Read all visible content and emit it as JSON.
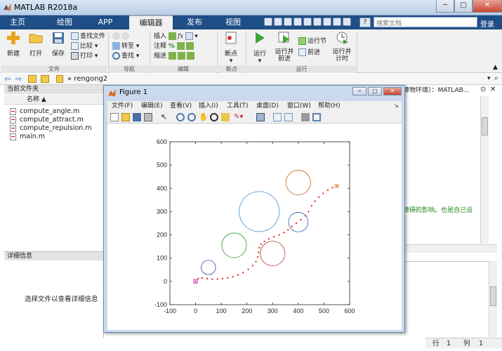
{
  "window": {
    "title": "MATLAB R2018a",
    "minimize": "─",
    "maximize": "□",
    "close": "✕"
  },
  "tabs": [
    {
      "label": "主页"
    },
    {
      "label": "绘图"
    },
    {
      "label": "APP"
    },
    {
      "label": "编辑器",
      "active": true
    },
    {
      "label": "发布"
    },
    {
      "label": "视图"
    }
  ],
  "search": {
    "placeholder": "搜索文档"
  },
  "login": "登录",
  "ribbon": {
    "file": {
      "new": "新建",
      "open": "打开",
      "save": "保存",
      "find_files": "查找文件",
      "compare": "比较",
      "print": "打印",
      "group": "文件"
    },
    "navigate": {
      "goto": "转至",
      "find": "查找",
      "group": "导航"
    },
    "edit": {
      "insert": "插入",
      "comment": "注释",
      "indent": "缩进",
      "group": "编辑"
    },
    "breakpoints": {
      "label": "断点",
      "group": "断点"
    },
    "run": {
      "run": "运行",
      "run_advance": "运行并前进",
      "run_section": "运行节",
      "advance": "前进",
      "run_time": "运行并计时",
      "group": "运行"
    }
  },
  "address": {
    "path": "« rengong2"
  },
  "current_folder": {
    "title": "当前文件夹",
    "column": "名称 ▲",
    "files": [
      "compute_angle.m",
      "compute_attract.m",
      "compute_repulsion.m",
      "main.m"
    ]
  },
  "details": {
    "title": "详细信息",
    "text": "选择文件以查看详细信息"
  },
  "workspace_title": "障物环境）：MATLAB...",
  "editor_snippet": "障碍的影响。也是自己设",
  "status": {
    "row_label": "行",
    "row": "1",
    "col_label": "列",
    "col": "1"
  },
  "figure": {
    "title": "Figure 1",
    "menu": [
      "文件(F)",
      "编辑(E)",
      "查看(V)",
      "插入(I)",
      "工具(T)",
      "桌面(D)",
      "窗口(W)",
      "帮助(H)"
    ]
  },
  "chart_data": {
    "type": "scatter",
    "title": "",
    "xlabel": "",
    "ylabel": "",
    "xlim": [
      -100,
      600
    ],
    "ylim": [
      -100,
      600
    ],
    "xticks": [
      -100,
      0,
      100,
      200,
      300,
      400,
      500,
      600
    ],
    "yticks": [
      -100,
      0,
      100,
      200,
      300,
      400,
      500,
      600
    ],
    "grid": false,
    "obstacles": [
      {
        "cx": 50,
        "cy": 60,
        "r": 28,
        "color": "#3f3fa0"
      },
      {
        "cx": 150,
        "cy": 155,
        "r": 48,
        "color": "#2e9b2e"
      },
      {
        "cx": 248,
        "cy": 300,
        "r": 78,
        "color": "#3c8fd6"
      },
      {
        "cx": 300,
        "cy": 120,
        "r": 48,
        "color": "#b0402c"
      },
      {
        "cx": 400,
        "cy": 255,
        "r": 38,
        "color": "#2a66b5"
      },
      {
        "cx": 400,
        "cy": 425,
        "r": 48,
        "color": "#c0661e"
      }
    ],
    "start": {
      "x": 0,
      "y": 0,
      "color": "#d000d0"
    },
    "goal": {
      "x": 550,
      "y": 410,
      "color": "#e0a030"
    },
    "path_color": "#dd1111",
    "path": [
      [
        0,
        0
      ],
      [
        10,
        12
      ],
      [
        25,
        15
      ],
      [
        45,
        12
      ],
      [
        65,
        10
      ],
      [
        85,
        10
      ],
      [
        105,
        12
      ],
      [
        125,
        15
      ],
      [
        145,
        20
      ],
      [
        165,
        28
      ],
      [
        185,
        38
      ],
      [
        205,
        52
      ],
      [
        222,
        68
      ],
      [
        235,
        85
      ],
      [
        242,
        105
      ],
      [
        245,
        125
      ],
      [
        248,
        145
      ],
      [
        255,
        160
      ],
      [
        268,
        172
      ],
      [
        285,
        183
      ],
      [
        305,
        192
      ],
      [
        325,
        200
      ],
      [
        345,
        210
      ],
      [
        360,
        222
      ],
      [
        375,
        236
      ],
      [
        392,
        250
      ],
      [
        410,
        265
      ],
      [
        428,
        282
      ],
      [
        440,
        300
      ],
      [
        452,
        325
      ],
      [
        465,
        345
      ],
      [
        480,
        362
      ],
      [
        497,
        378
      ],
      [
        515,
        392
      ],
      [
        533,
        403
      ],
      [
        550,
        410
      ]
    ]
  }
}
